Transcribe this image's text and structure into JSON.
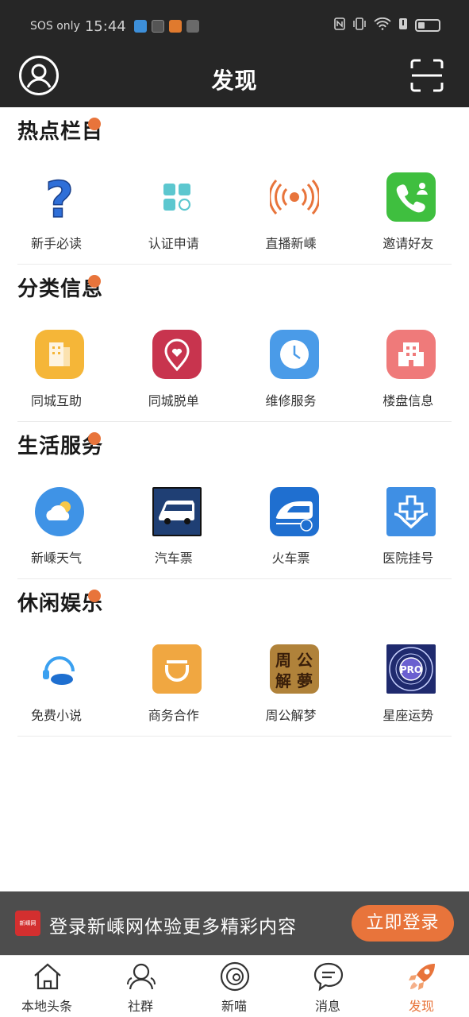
{
  "status_bar": {
    "carrier": "SOS only",
    "time": "15:44"
  },
  "header": {
    "title": "发现"
  },
  "sections": [
    {
      "title": "热点栏目",
      "items": [
        {
          "label": "新手必读",
          "icon": "question-mark-icon"
        },
        {
          "label": "认证申请",
          "icon": "grid-apps-icon"
        },
        {
          "label": "直播新嵊",
          "icon": "live-broadcast-icon"
        },
        {
          "label": "邀请好友",
          "icon": "phone-invite-icon"
        }
      ]
    },
    {
      "title": "分类信息",
      "items": [
        {
          "label": "同城互助",
          "icon": "building-help-icon"
        },
        {
          "label": "同城脱单",
          "icon": "heart-location-icon"
        },
        {
          "label": "维修服务",
          "icon": "clock-repair-icon"
        },
        {
          "label": "楼盘信息",
          "icon": "building-icon"
        }
      ]
    },
    {
      "title": "生活服务",
      "items": [
        {
          "label": "新嵊天气",
          "icon": "weather-icon"
        },
        {
          "label": "汽车票",
          "icon": "bus-icon"
        },
        {
          "label": "火车票",
          "icon": "train-icon"
        },
        {
          "label": "医院挂号",
          "icon": "hospital-icon"
        }
      ]
    },
    {
      "title": "休闲娱乐",
      "items": [
        {
          "label": "免费小说",
          "icon": "headset-icon"
        },
        {
          "label": "商务合作",
          "icon": "didi-icon"
        },
        {
          "label": "周公解梦",
          "icon": "dream-icon"
        },
        {
          "label": "星座运势",
          "icon": "zodiac-icon"
        }
      ]
    }
  ],
  "dream_icon_text": [
    "周",
    "公",
    "解",
    "夢"
  ],
  "zodiac_icon_text": "PRO",
  "login_banner": {
    "text": "登录新嵊网体验更多精彩内容",
    "button": "立即登录",
    "logo_text": "新嵊网"
  },
  "tabs": [
    {
      "label": "本地头条",
      "icon": "home-icon"
    },
    {
      "label": "社群",
      "icon": "community-icon"
    },
    {
      "label": "新喵",
      "icon": "planet-icon"
    },
    {
      "label": "消息",
      "icon": "message-icon"
    },
    {
      "label": "发现",
      "icon": "rocket-icon",
      "active": true
    }
  ],
  "colors": {
    "accent": "#e8743b",
    "header": "#262626"
  }
}
